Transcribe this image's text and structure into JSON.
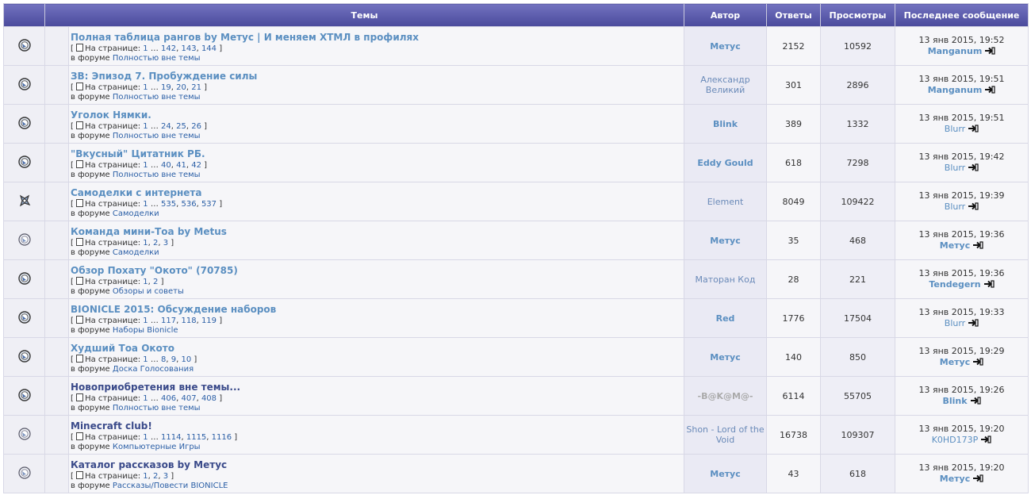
{
  "header": {
    "topics": "Темы",
    "author": "Автор",
    "replies": "Ответы",
    "views": "Просмотры",
    "last_post": "Последнее сообщение"
  },
  "labels": {
    "on_page": "На странице:",
    "in_forum": "в форуме"
  },
  "rows": [
    {
      "icon": "hot-topic-icon",
      "title": "Полная таблица рангов by Метус | И меняем XTМЛ в профилях",
      "title_dark": false,
      "pages": [
        "1",
        "…",
        "142",
        "143",
        "144"
      ],
      "forum": "Полностью вне темы",
      "author": "Метус",
      "author_style": "bold",
      "replies": "2152",
      "views": "10592",
      "last_date": "13 янв 2015, 19:52",
      "last_user": "Manganum",
      "last_bold": true
    },
    {
      "icon": "hot-topic-icon",
      "title": "ЗВ: Эпизод 7. Пробуждение силы",
      "title_dark": false,
      "pages": [
        "1",
        "…",
        "19",
        "20",
        "21"
      ],
      "forum": "Полностью вне темы",
      "author": "Александр Великий",
      "author_style": "greyish",
      "replies": "301",
      "views": "2896",
      "last_date": "13 янв 2015, 19:51",
      "last_user": "Manganum",
      "last_bold": true
    },
    {
      "icon": "hot-topic-icon",
      "title": "Уголок Нямки.",
      "title_dark": false,
      "pages": [
        "1",
        "…",
        "24",
        "25",
        "26"
      ],
      "forum": "Полностью вне темы",
      "author": "Blink",
      "author_style": "bold",
      "replies": "389",
      "views": "1332",
      "last_date": "13 янв 2015, 19:51",
      "last_user": "Blurr",
      "last_bold": false
    },
    {
      "icon": "hot-topic-icon",
      "title": "\"Вкусный\" Цитатник РБ.",
      "title_dark": false,
      "pages": [
        "1",
        "…",
        "40",
        "41",
        "42"
      ],
      "forum": "Полностью вне темы",
      "author": "Eddy Gould",
      "author_style": "bold",
      "replies": "618",
      "views": "7298",
      "last_date": "13 янв 2015, 19:42",
      "last_user": "Blurr",
      "last_bold": false
    },
    {
      "icon": "mixed-topic-icon",
      "title": "Самоделки с интернета",
      "title_dark": false,
      "pages": [
        "1",
        "…",
        "535",
        "536",
        "537"
      ],
      "forum": "Самоделки",
      "author": "Element",
      "author_style": "greyish",
      "replies": "8049",
      "views": "109422",
      "last_date": "13 янв 2015, 19:39",
      "last_user": "Blurr",
      "last_bold": false
    },
    {
      "icon": "topic-icon",
      "title": "Команда мини-Тоа by Metus",
      "title_dark": false,
      "pages": [
        "1",
        "2",
        "3"
      ],
      "forum": "Самоделки",
      "author": "Метус",
      "author_style": "bold",
      "replies": "35",
      "views": "468",
      "last_date": "13 янв 2015, 19:36",
      "last_user": "Метус",
      "last_bold": true
    },
    {
      "icon": "hot-topic-icon",
      "title": "Обзор Похату \"Окото\" (70785)",
      "title_dark": false,
      "pages": [
        "1",
        "2"
      ],
      "forum": "Обзоры и советы",
      "author": "Маторан Код",
      "author_style": "greyish",
      "replies": "28",
      "views": "221",
      "last_date": "13 янв 2015, 19:36",
      "last_user": "Tendegern",
      "last_bold": true
    },
    {
      "icon": "hot-topic-icon",
      "title": "BIONICLE 2015: Обсуждение наборов",
      "title_dark": false,
      "pages": [
        "1",
        "…",
        "117",
        "118",
        "119"
      ],
      "forum": "Наборы Bionicle",
      "author": "Red",
      "author_style": "bold",
      "replies": "1776",
      "views": "17504",
      "last_date": "13 янв 2015, 19:33",
      "last_user": "Blurr",
      "last_bold": false
    },
    {
      "icon": "hot-topic-icon",
      "title": "Худший Тоа Окото",
      "title_dark": false,
      "pages": [
        "1",
        "…",
        "8",
        "9",
        "10"
      ],
      "forum": "Доска Голосования",
      "author": "Метус",
      "author_style": "bold",
      "replies": "140",
      "views": "850",
      "last_date": "13 янв 2015, 19:29",
      "last_user": "Метус",
      "last_bold": true
    },
    {
      "icon": "hot-topic-icon",
      "title": "Новоприобретения вне темы...",
      "title_dark": true,
      "pages": [
        "1",
        "…",
        "406",
        "407",
        "408"
      ],
      "forum": "Полностью вне темы",
      "author": "-B@K@M@-",
      "author_style": "anon",
      "replies": "6114",
      "views": "55705",
      "last_date": "13 янв 2015, 19:26",
      "last_user": "Blink",
      "last_bold": true
    },
    {
      "icon": "topic-icon",
      "title": "Minecraft club!",
      "title_dark": true,
      "pages": [
        "1",
        "…",
        "1114",
        "1115",
        "1116"
      ],
      "forum": "Компьютерные Игры",
      "author": "Shon - Lord of the Void",
      "author_style": "greyish",
      "replies": "16738",
      "views": "109307",
      "last_date": "13 янв 2015, 19:20",
      "last_user": "K0HD173P",
      "last_bold": false
    },
    {
      "icon": "topic-icon",
      "title": "Каталог рассказов by Метус",
      "title_dark": true,
      "pages": [
        "1",
        "2",
        "3"
      ],
      "forum": "Рассказы/Повести BIONICLE",
      "author": "Метус",
      "author_style": "bold",
      "replies": "43",
      "views": "618",
      "last_date": "13 янв 2015, 19:20",
      "last_user": "Метус",
      "last_bold": true
    }
  ]
}
